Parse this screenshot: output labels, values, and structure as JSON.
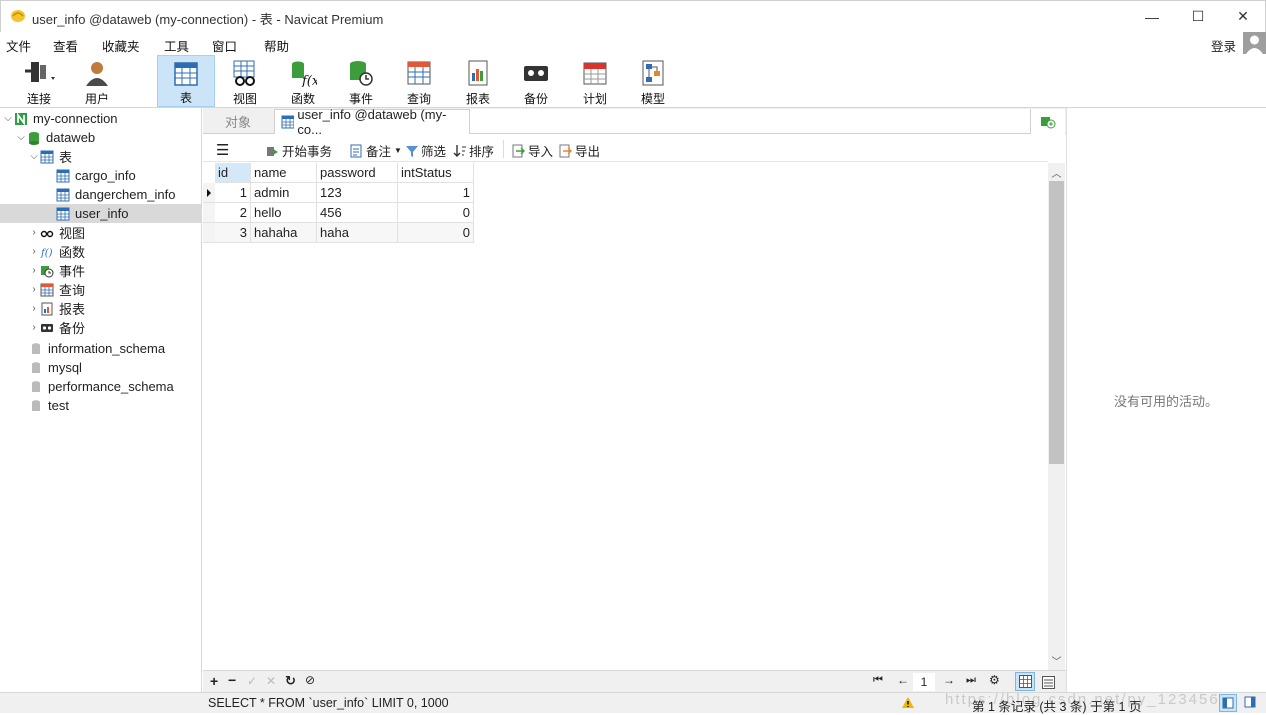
{
  "window": {
    "title": "user_info @dataweb (my-connection) - 表 - Navicat Premium",
    "minimize": "—",
    "maximize": "☐",
    "close": "✕"
  },
  "menu": [
    "文件",
    "查看",
    "收藏夹",
    "工具",
    "窗口",
    "帮助"
  ],
  "login_label": "登录",
  "toolbar": [
    {
      "label": "连接",
      "icon": "connect-icon"
    },
    {
      "label": "用户",
      "icon": "user-icon"
    },
    {
      "label": "表",
      "icon": "table-icon"
    },
    {
      "label": "视图",
      "icon": "view-icon"
    },
    {
      "label": "函数",
      "icon": "function-icon"
    },
    {
      "label": "事件",
      "icon": "event-icon"
    },
    {
      "label": "查询",
      "icon": "query-icon"
    },
    {
      "label": "报表",
      "icon": "report-icon"
    },
    {
      "label": "备份",
      "icon": "backup-icon"
    },
    {
      "label": "计划",
      "icon": "schedule-icon"
    },
    {
      "label": "模型",
      "icon": "model-icon"
    }
  ],
  "sidebar": {
    "connection": "my-connection",
    "database": "dataweb",
    "tables_group": "表",
    "tables": [
      "cargo_info",
      "dangerchem_info",
      "user_info"
    ],
    "selected_table": "user_info",
    "groups": [
      "视图",
      "函数",
      "事件",
      "查询",
      "报表",
      "备份"
    ],
    "other_databases": [
      "information_schema",
      "mysql",
      "performance_schema",
      "test"
    ]
  },
  "tabs": {
    "objects": "对象",
    "active": "user_info @dataweb (my-co..."
  },
  "subtoolbar": {
    "begin_transaction": "开始事务",
    "memo": "备注",
    "filter": "筛选",
    "sort": "排序",
    "import": "导入",
    "export": "导出"
  },
  "grid": {
    "columns": [
      "id",
      "name",
      "password",
      "intStatus"
    ],
    "rows": [
      [
        "1",
        "admin",
        "123",
        "1"
      ],
      [
        "2",
        "hello",
        "456",
        "0"
      ],
      [
        "3",
        "hahaha",
        "haha",
        "0"
      ]
    ]
  },
  "pagination": {
    "page": "1"
  },
  "status": {
    "sql": "SELECT * FROM `user_info` LIMIT 0, 1000",
    "record_info": "第 1 条记录 (共 3 条) 于第 1 页",
    "watermark": "https://blog.csdn.net/py_123456"
  },
  "right_panel": {
    "message": "没有可用的活动。"
  },
  "colors": {
    "accent": "#cce4f7",
    "selected_row": "#d9d9d9"
  }
}
